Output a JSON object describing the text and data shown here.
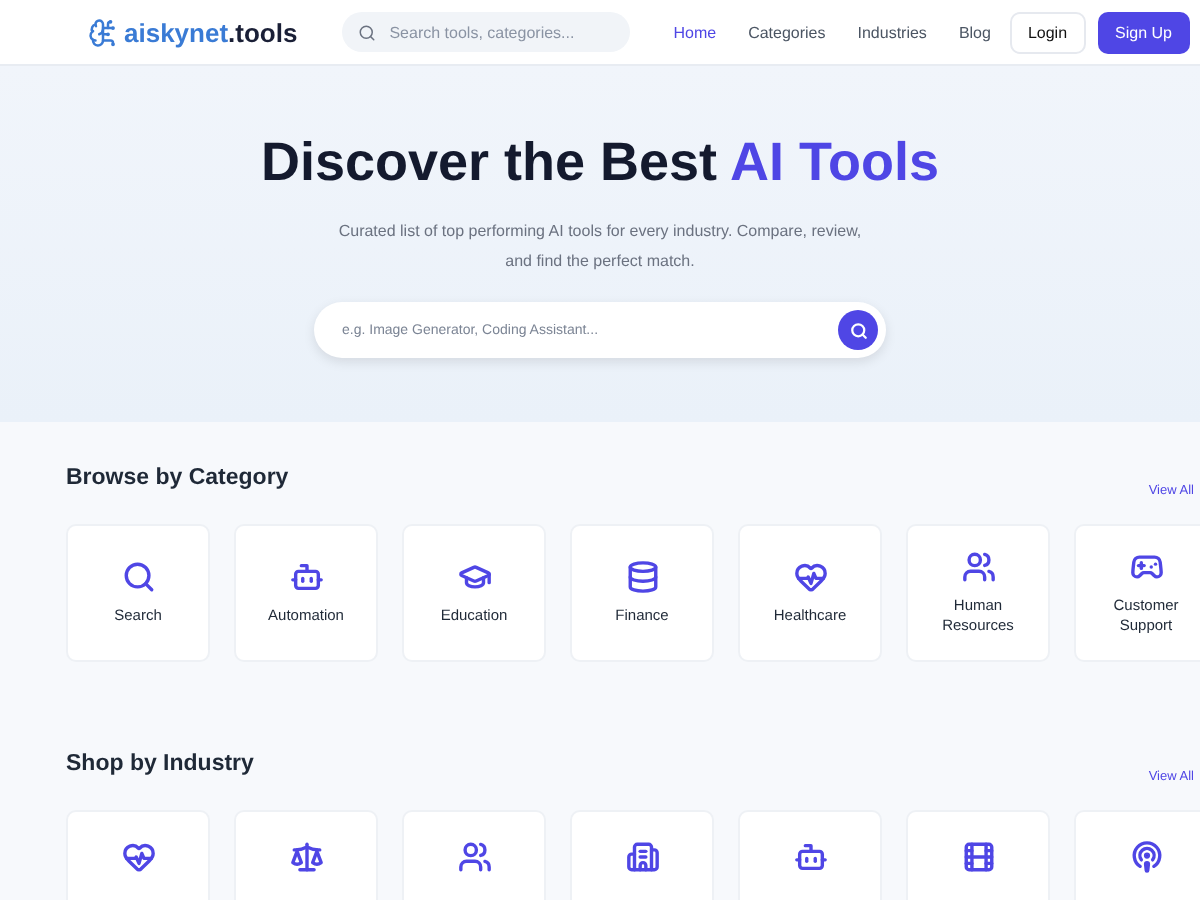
{
  "header": {
    "logo_name": "aiskynet",
    "logo_suffix": ".tools",
    "search": {
      "placeholder": "Search tools, categories..."
    },
    "nav": [
      {
        "label": "Home",
        "selected": true
      },
      {
        "label": "Categories",
        "selected": false
      },
      {
        "label": "Industries",
        "selected": false
      },
      {
        "label": "Blog",
        "selected": false
      }
    ],
    "login": "Login",
    "signup": "Sign Up"
  },
  "hero": {
    "title": "Discover the Best ",
    "title_highlight": "AI Tools",
    "subtitle": "Curated list of top performing AI tools for every industry. Compare, review, and find the perfect match.",
    "search": {
      "placeholder": "e.g. Image Generator, Coding Assistant..."
    }
  },
  "categories": {
    "title": "Browse by Category",
    "link": "View All",
    "items": [
      {
        "label": "Search"
      },
      {
        "label": "Automation"
      },
      {
        "label": "Education"
      },
      {
        "label": "Finance"
      },
      {
        "label": "Healthcare"
      },
      {
        "label": "Human Resources"
      },
      {
        "label": "Customer Support"
      }
    ]
  },
  "industries": {
    "title": "Shop by Industry",
    "link": "View All"
  }
}
